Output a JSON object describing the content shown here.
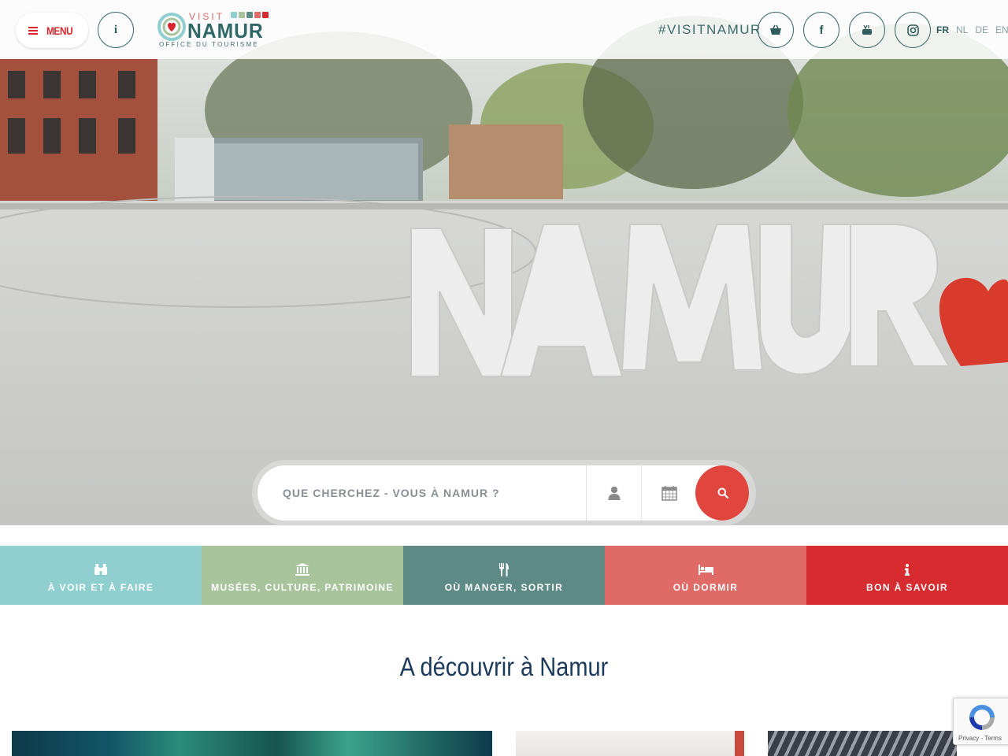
{
  "header": {
    "menu_label": "MENU",
    "info_label": "i",
    "logo": {
      "visit": "VISIT",
      "name": "NAMUR",
      "subtitle": "OFFICE DU TOURISME"
    },
    "hashtag": "#VISITNAMUR",
    "social": [
      {
        "name": "shop-bag-icon"
      },
      {
        "name": "facebook-icon",
        "glyph": "f"
      },
      {
        "name": "youtube-icon"
      },
      {
        "name": "instagram-icon"
      }
    ],
    "languages": [
      {
        "code": "FR",
        "active": true
      },
      {
        "code": "NL",
        "active": false
      },
      {
        "code": "DE",
        "active": false
      },
      {
        "code": "EN",
        "active": false
      }
    ]
  },
  "hero": {
    "sign_text": "NAMUR"
  },
  "search": {
    "placeholder": "QUE CHERCHEZ - VOUS À NAMUR ?",
    "value": ""
  },
  "categories": [
    {
      "label": "À VOIR ET À FAIRE",
      "icon": "binoculars-icon",
      "color": "#8fcfcf"
    },
    {
      "label": "MUSÉES, CULTURE, PATRIMOINE",
      "icon": "museum-icon",
      "color": "#a8c49c"
    },
    {
      "label": "OÙ MANGER, SORTIR",
      "icon": "cutlery-icon",
      "color": "#5e8a85"
    },
    {
      "label": "OÙ DORMIR",
      "icon": "bed-icon",
      "color": "#e06a66"
    },
    {
      "label": "BON À SAVOIR",
      "icon": "info-icon",
      "color": "#d62b2f"
    }
  ],
  "section": {
    "title": "A découvrir à Namur"
  },
  "recaptcha": {
    "terms": "Privacy - Terms"
  },
  "colors": {
    "brand_teal": "#2f6668",
    "brand_red": "#d9272d",
    "search_go": "#e0463d",
    "title": "#1b3a5c"
  }
}
